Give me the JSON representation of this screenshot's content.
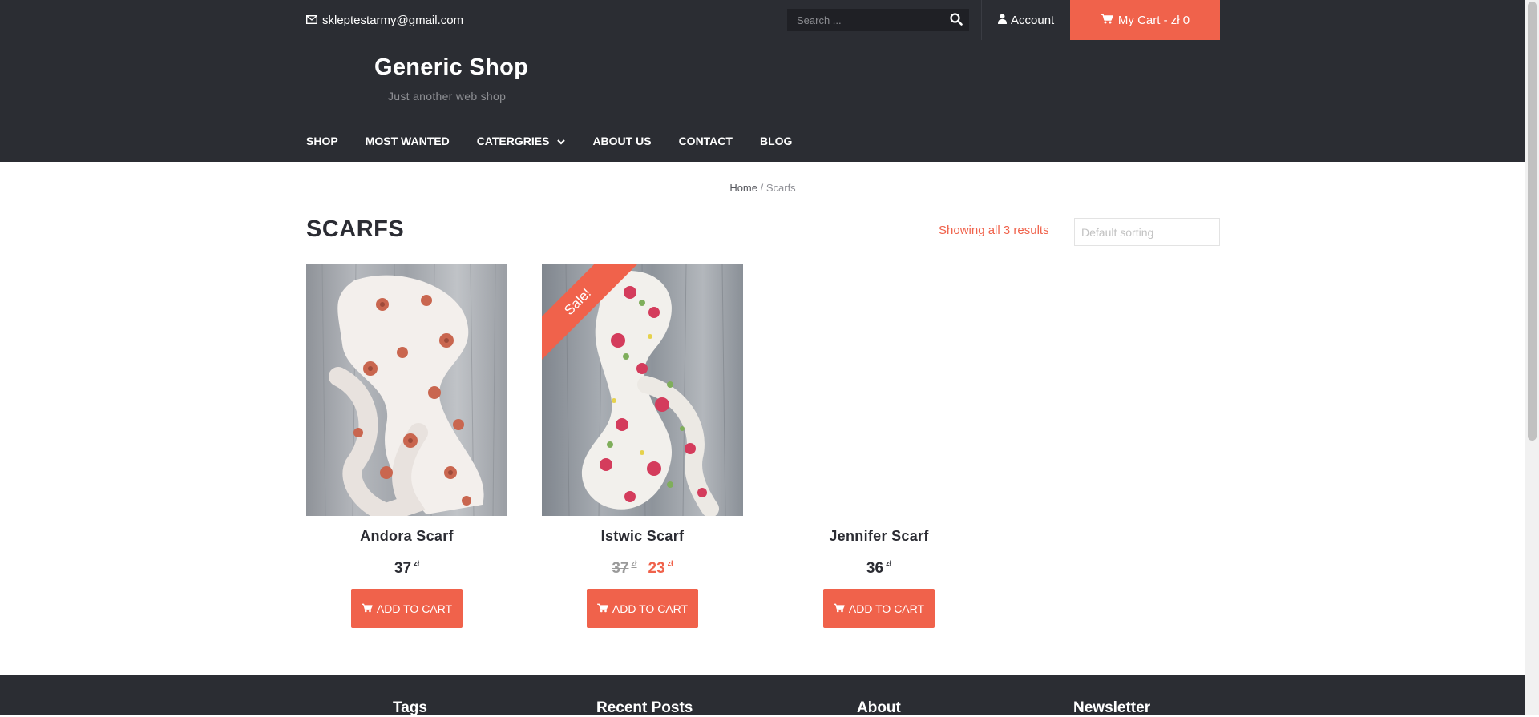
{
  "topbar": {
    "email": "skleptestarmy@gmail.com",
    "search_placeholder": "Search ...",
    "account_label": "Account",
    "cart_label": "My Cart - zł 0"
  },
  "header": {
    "site_title": "Generic Shop",
    "tagline": "Just another web shop"
  },
  "nav": {
    "items": [
      "SHOP",
      "MOST WANTED",
      "CATERGRIES",
      "ABOUT US",
      "CONTACT",
      "BLOG"
    ]
  },
  "breadcrumb": {
    "home": "Home",
    "separator": " / ",
    "current": "Scarfs"
  },
  "page": {
    "title": "SCARFS",
    "result_count": "Showing all 3 results",
    "sorting_placeholder": "Default sorting"
  },
  "products": [
    {
      "name": "Andora Scarf",
      "price": "37",
      "currency": "zł",
      "button": "ADD TO CART",
      "has_image": true
    },
    {
      "name": "Istwic Scarf",
      "old_price": "37",
      "price": "23",
      "currency": "zł",
      "sale_badge": "Sale!",
      "button": "ADD TO CART",
      "has_image": true
    },
    {
      "name": "Jennifer Scarf",
      "price": "36",
      "currency": "zł",
      "button": "ADD TO CART",
      "has_image": false
    }
  ],
  "footer": {
    "columns": [
      "Tags",
      "Recent Posts",
      "About",
      "Newsletter"
    ]
  },
  "colors": {
    "accent": "#f0624b",
    "dark_bg": "#2b2d33",
    "text_dark": "#2b2c33"
  },
  "icons": {
    "email": "envelope-icon",
    "search": "search-icon",
    "account": "user-icon",
    "cart": "cart-icon",
    "dropdown": "chevron-down-icon"
  }
}
